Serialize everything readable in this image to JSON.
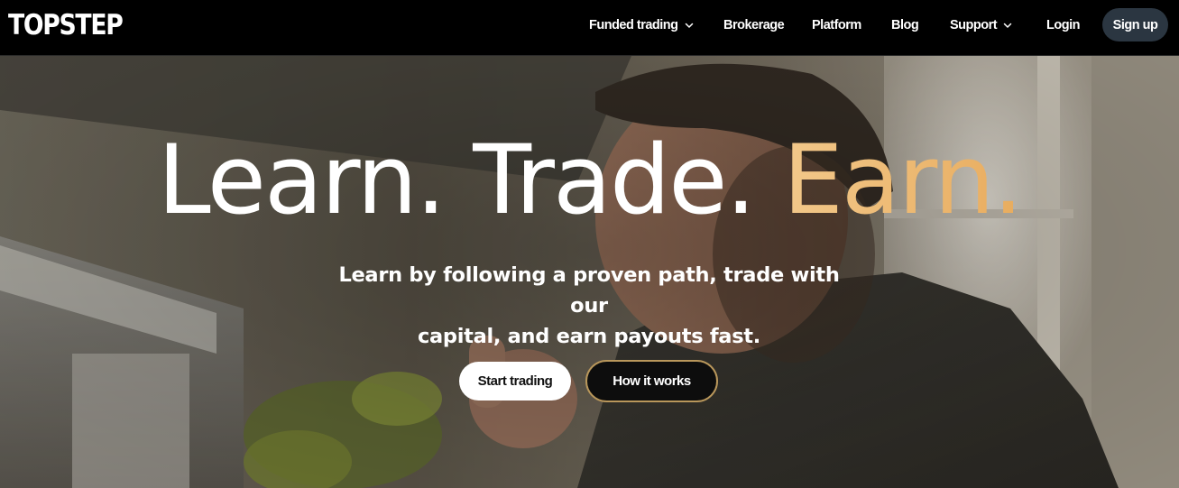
{
  "header": {
    "logo": "TOPSTEP",
    "nav": {
      "funded_trading": "Funded trading",
      "brokerage": "Brokerage",
      "platform": "Platform",
      "blog": "Blog",
      "support": "Support",
      "login": "Login"
    },
    "signup_label": "Sign up"
  },
  "hero": {
    "headline": {
      "word1": "Learn.",
      "word2": "Trade.",
      "word3": "Earn."
    },
    "subtitle_line1": "Learn by following a proven path, trade with our",
    "subtitle_line2": "capital, and earn payouts fast.",
    "primary_cta": "Start trading",
    "secondary_cta": "How it works"
  },
  "colors": {
    "nav_bg": "#000000",
    "signup_bg": "#2b3641",
    "accent_gold": "#e8ac5e",
    "cta_border": "#b9975b"
  },
  "icons": {
    "funded_trading_dropdown": "chevron-down-icon",
    "support_dropdown": "chevron-down-icon"
  }
}
